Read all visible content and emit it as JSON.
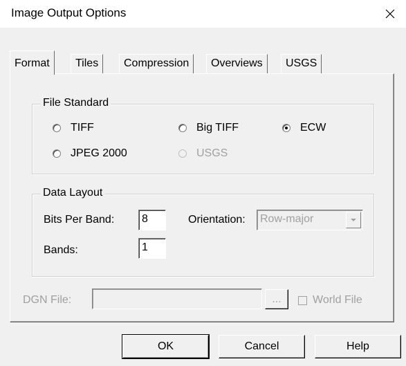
{
  "window": {
    "title": "Image Output Options",
    "close_icon": "close-icon"
  },
  "tabs": [
    {
      "label": "Format",
      "active": true
    },
    {
      "label": "Tiles",
      "active": false
    },
    {
      "label": "Compression",
      "active": false
    },
    {
      "label": "Overviews",
      "active": false
    },
    {
      "label": "USGS",
      "active": false
    }
  ],
  "file_standard": {
    "title": "File Standard",
    "options": [
      {
        "label": "TIFF",
        "selected": false,
        "enabled": true
      },
      {
        "label": "Big TIFF",
        "selected": false,
        "enabled": true
      },
      {
        "label": "ECW",
        "selected": true,
        "enabled": true
      },
      {
        "label": "JPEG 2000",
        "selected": false,
        "enabled": true
      },
      {
        "label": "USGS",
        "selected": false,
        "enabled": false
      }
    ]
  },
  "data_layout": {
    "title": "Data Layout",
    "bits_per_band_label": "Bits Per Band:",
    "bits_per_band_value": "8",
    "orientation_label": "Orientation:",
    "orientation_value": "Row-major",
    "bands_label": "Bands:",
    "bands_value": "1"
  },
  "dgn": {
    "label": "DGN File:",
    "value": "",
    "browse_label": "...",
    "world_file_label": "World File"
  },
  "buttons": {
    "ok": "OK",
    "cancel": "Cancel",
    "help": "Help"
  }
}
